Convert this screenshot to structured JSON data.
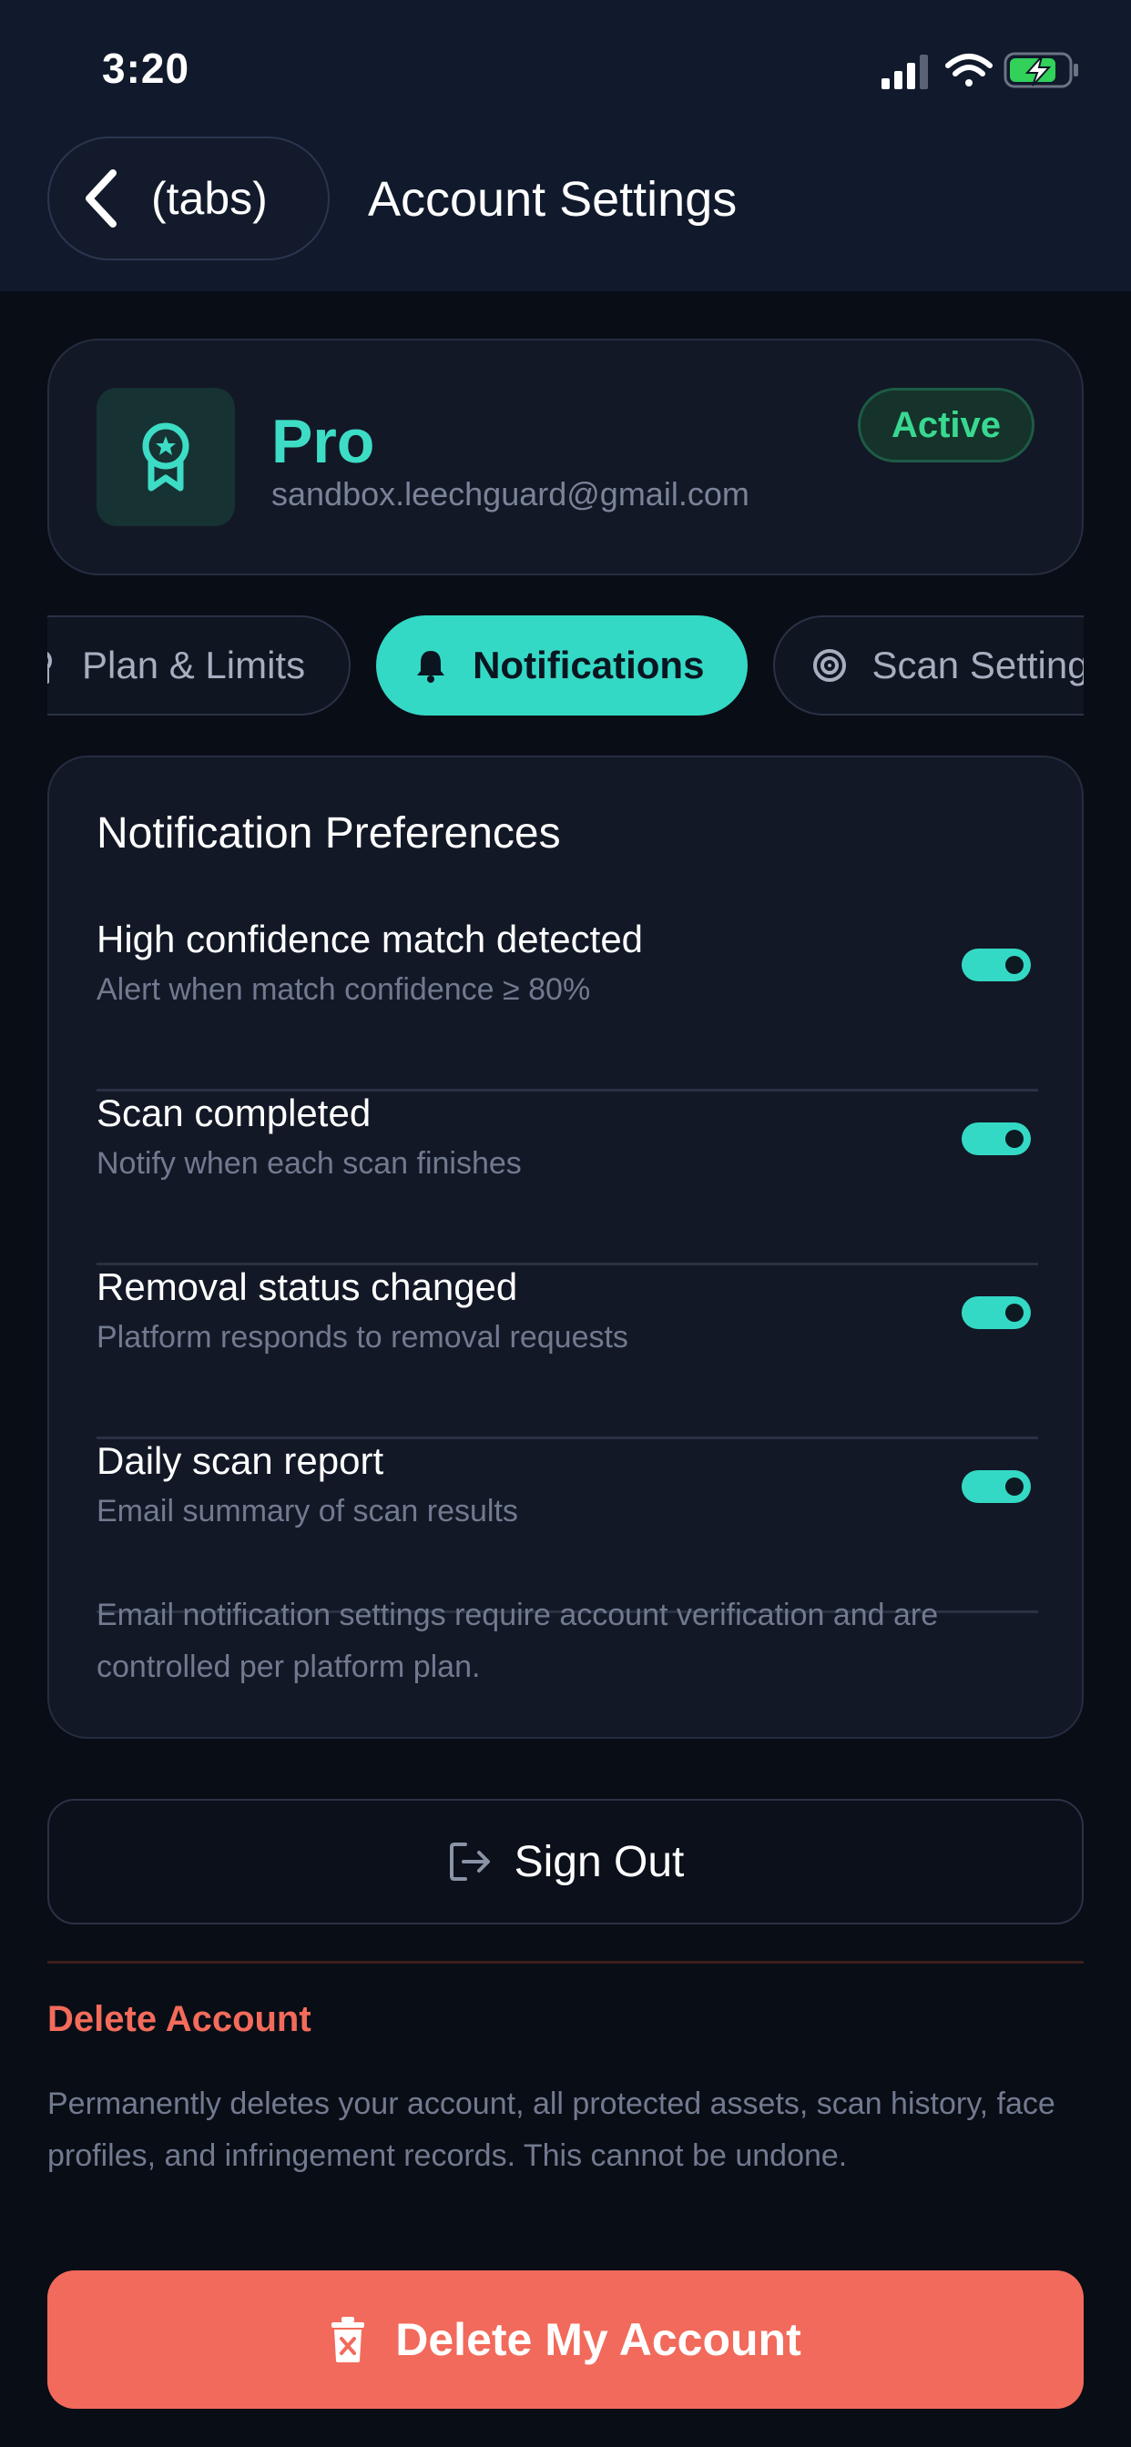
{
  "status_bar": {
    "time": "3:20"
  },
  "header": {
    "back_label": "(tabs)",
    "title": "Account Settings"
  },
  "plan": {
    "name": "Pro",
    "email": "sandbox.leechguard@gmail.com",
    "status": "Active"
  },
  "tabs": [
    {
      "label": "Plan & Limits",
      "icon": "award-icon",
      "active": false
    },
    {
      "label": "Notifications",
      "icon": "bell-icon",
      "active": true
    },
    {
      "label": "Scan Settings",
      "icon": "target-icon",
      "active": false
    }
  ],
  "notifications": {
    "title": "Notification Preferences",
    "items": [
      {
        "title": "High confidence match detected",
        "subtitle": "Alert when match confidence ≥ 80%",
        "enabled": true
      },
      {
        "title": "Scan completed",
        "subtitle": "Notify when each scan finishes",
        "enabled": true
      },
      {
        "title": "Removal status changed",
        "subtitle": "Platform responds to removal requests",
        "enabled": true
      },
      {
        "title": "Daily scan report",
        "subtitle": "Email summary of scan results",
        "enabled": true
      }
    ],
    "note": "Email notification settings require account verification and are controlled per platform plan."
  },
  "sign_out": {
    "label": "Sign Out"
  },
  "danger": {
    "heading": "Delete Account",
    "description": "Permanently deletes your account, all protected assets, scan history, face profiles, and infringement records. This cannot be undone.",
    "button_label": "Delete My Account"
  },
  "colors": {
    "accent": "#34d9c5",
    "active_badge": "#39d890",
    "danger": "#f26a5b",
    "background": "#090d16",
    "header": "#111a2c"
  }
}
